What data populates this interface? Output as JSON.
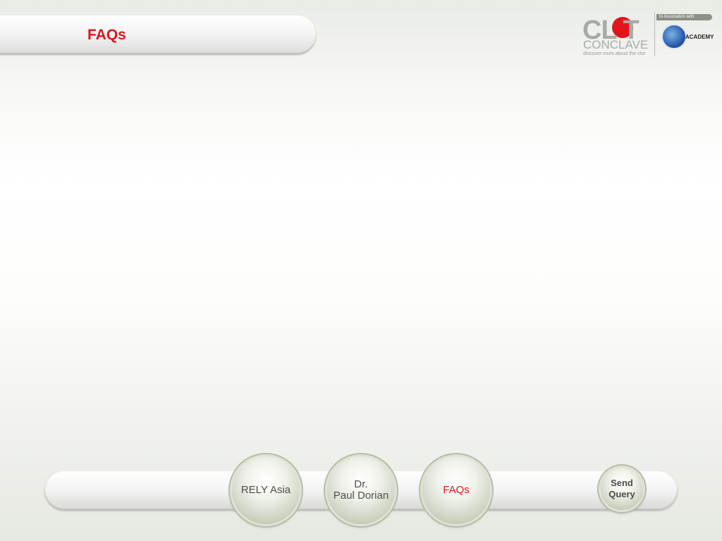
{
  "header": {
    "title": "FAQs"
  },
  "logo": {
    "clot": "CL T",
    "conclave": "CONCLAVE",
    "tagline": "discover more about the clot",
    "assoc": "In Association with",
    "academy": "ACADEMY"
  },
  "nav": {
    "items": [
      {
        "label": "RELY Asia"
      },
      {
        "label_line1": "Dr.",
        "label_line2": "Paul Dorian"
      },
      {
        "label": "FAQs"
      },
      {
        "label_line1": "Send",
        "label_line2": "Query"
      }
    ],
    "active_color": "#e0141e"
  }
}
